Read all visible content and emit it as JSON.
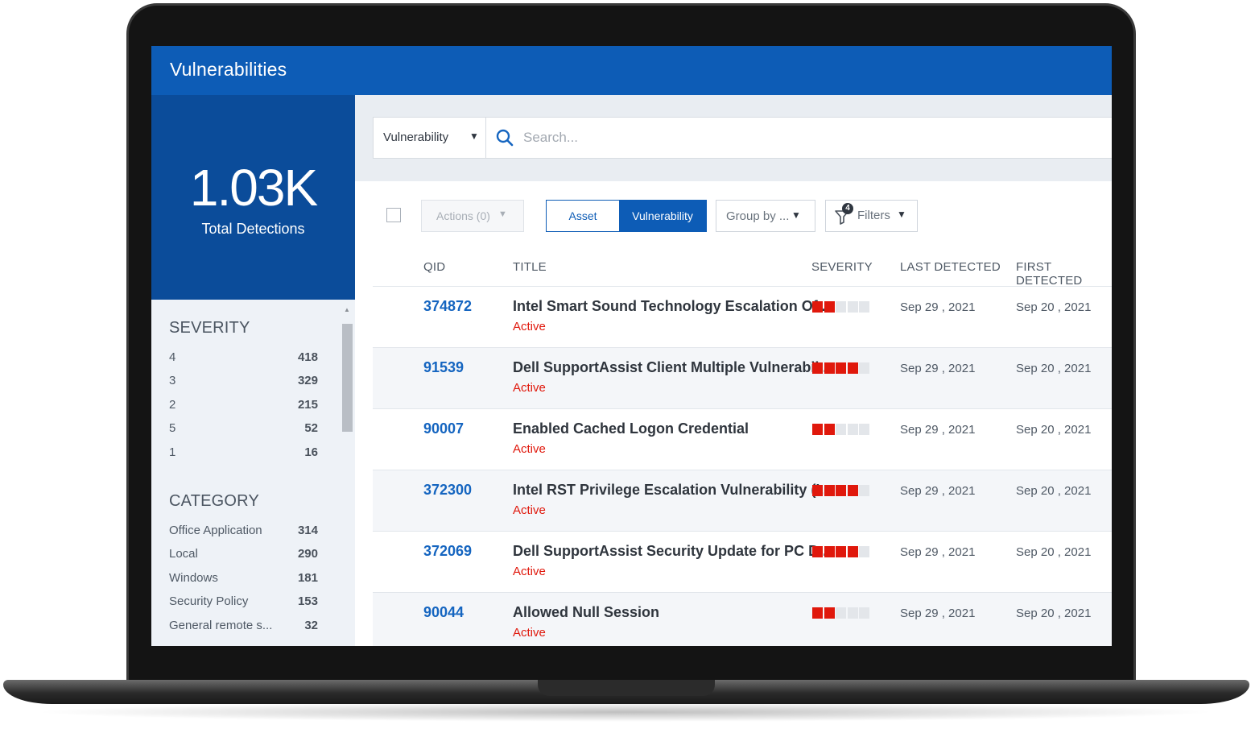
{
  "app": {
    "title": "Vulnerabilities"
  },
  "summary": {
    "value": "1.03K",
    "label": "Total Detections"
  },
  "facets": {
    "severity": {
      "heading": "SEVERITY",
      "items": [
        {
          "label": "4",
          "count": "418"
        },
        {
          "label": "3",
          "count": "329"
        },
        {
          "label": "2",
          "count": "215"
        },
        {
          "label": "5",
          "count": "52"
        },
        {
          "label": "1",
          "count": "16"
        }
      ]
    },
    "category": {
      "heading": "CATEGORY",
      "items": [
        {
          "label": "Office Application",
          "count": "314"
        },
        {
          "label": "Local",
          "count": "290"
        },
        {
          "label": "Windows",
          "count": "181"
        },
        {
          "label": "Security Policy",
          "count": "153"
        },
        {
          "label": "General remote s...",
          "count": "32"
        }
      ]
    }
  },
  "search": {
    "scope": "Vulnerability",
    "placeholder": "Search..."
  },
  "toolbar": {
    "actions_label": "Actions (0)",
    "toggle": {
      "asset": "Asset",
      "vulnerability": "Vulnerability",
      "selected": "Vulnerability"
    },
    "group_by_label": "Group by ...",
    "filters_label": "Filters",
    "filters_count": "4"
  },
  "table": {
    "columns": [
      "QID",
      "Title",
      "Severity",
      "Last Detected",
      "First Detected"
    ],
    "rows": [
      {
        "qid": "374872",
        "title": "Intel Smart Sound Technology Escalation Of ...",
        "status": "Active",
        "severity": 2,
        "last": "Sep 29 , 2021",
        "first": "Sep 20 , 2021"
      },
      {
        "qid": "91539",
        "title": "Dell SupportAssist Client Multiple Vulnerabil...",
        "status": "Active",
        "severity": 4,
        "last": "Sep 29 , 2021",
        "first": "Sep 20 , 2021"
      },
      {
        "qid": "90007",
        "title": "Enabled Cached Logon Credential",
        "status": "Active",
        "severity": 2,
        "last": "Sep 29 , 2021",
        "first": "Sep 20 , 2021"
      },
      {
        "qid": "372300",
        "title": "Intel RST Privilege Escalation Vulnerability (I...",
        "status": "Active",
        "severity": 4,
        "last": "Sep 29 , 2021",
        "first": "Sep 20 , 2021"
      },
      {
        "qid": "372069",
        "title": "Dell SupportAssist Security Update for PC D...",
        "status": "Active",
        "severity": 4,
        "last": "Sep 29 , 2021",
        "first": "Sep 20 , 2021"
      },
      {
        "qid": "90044",
        "title": "Allowed Null Session",
        "status": "Active",
        "severity": 2,
        "last": "Sep 29 , 2021",
        "first": "Sep 20 , 2021"
      }
    ],
    "severity_max": 5
  },
  "colors": {
    "header_blue": "#0d5cb6",
    "summary_blue": "#0b4c9a",
    "link_blue": "#1565c0",
    "active_red": "#e0180c"
  },
  "icons": {
    "search": "search-icon",
    "filter": "filter-icon",
    "caret": "caret-down-icon",
    "scroll_up": "scroll-up-icon"
  }
}
